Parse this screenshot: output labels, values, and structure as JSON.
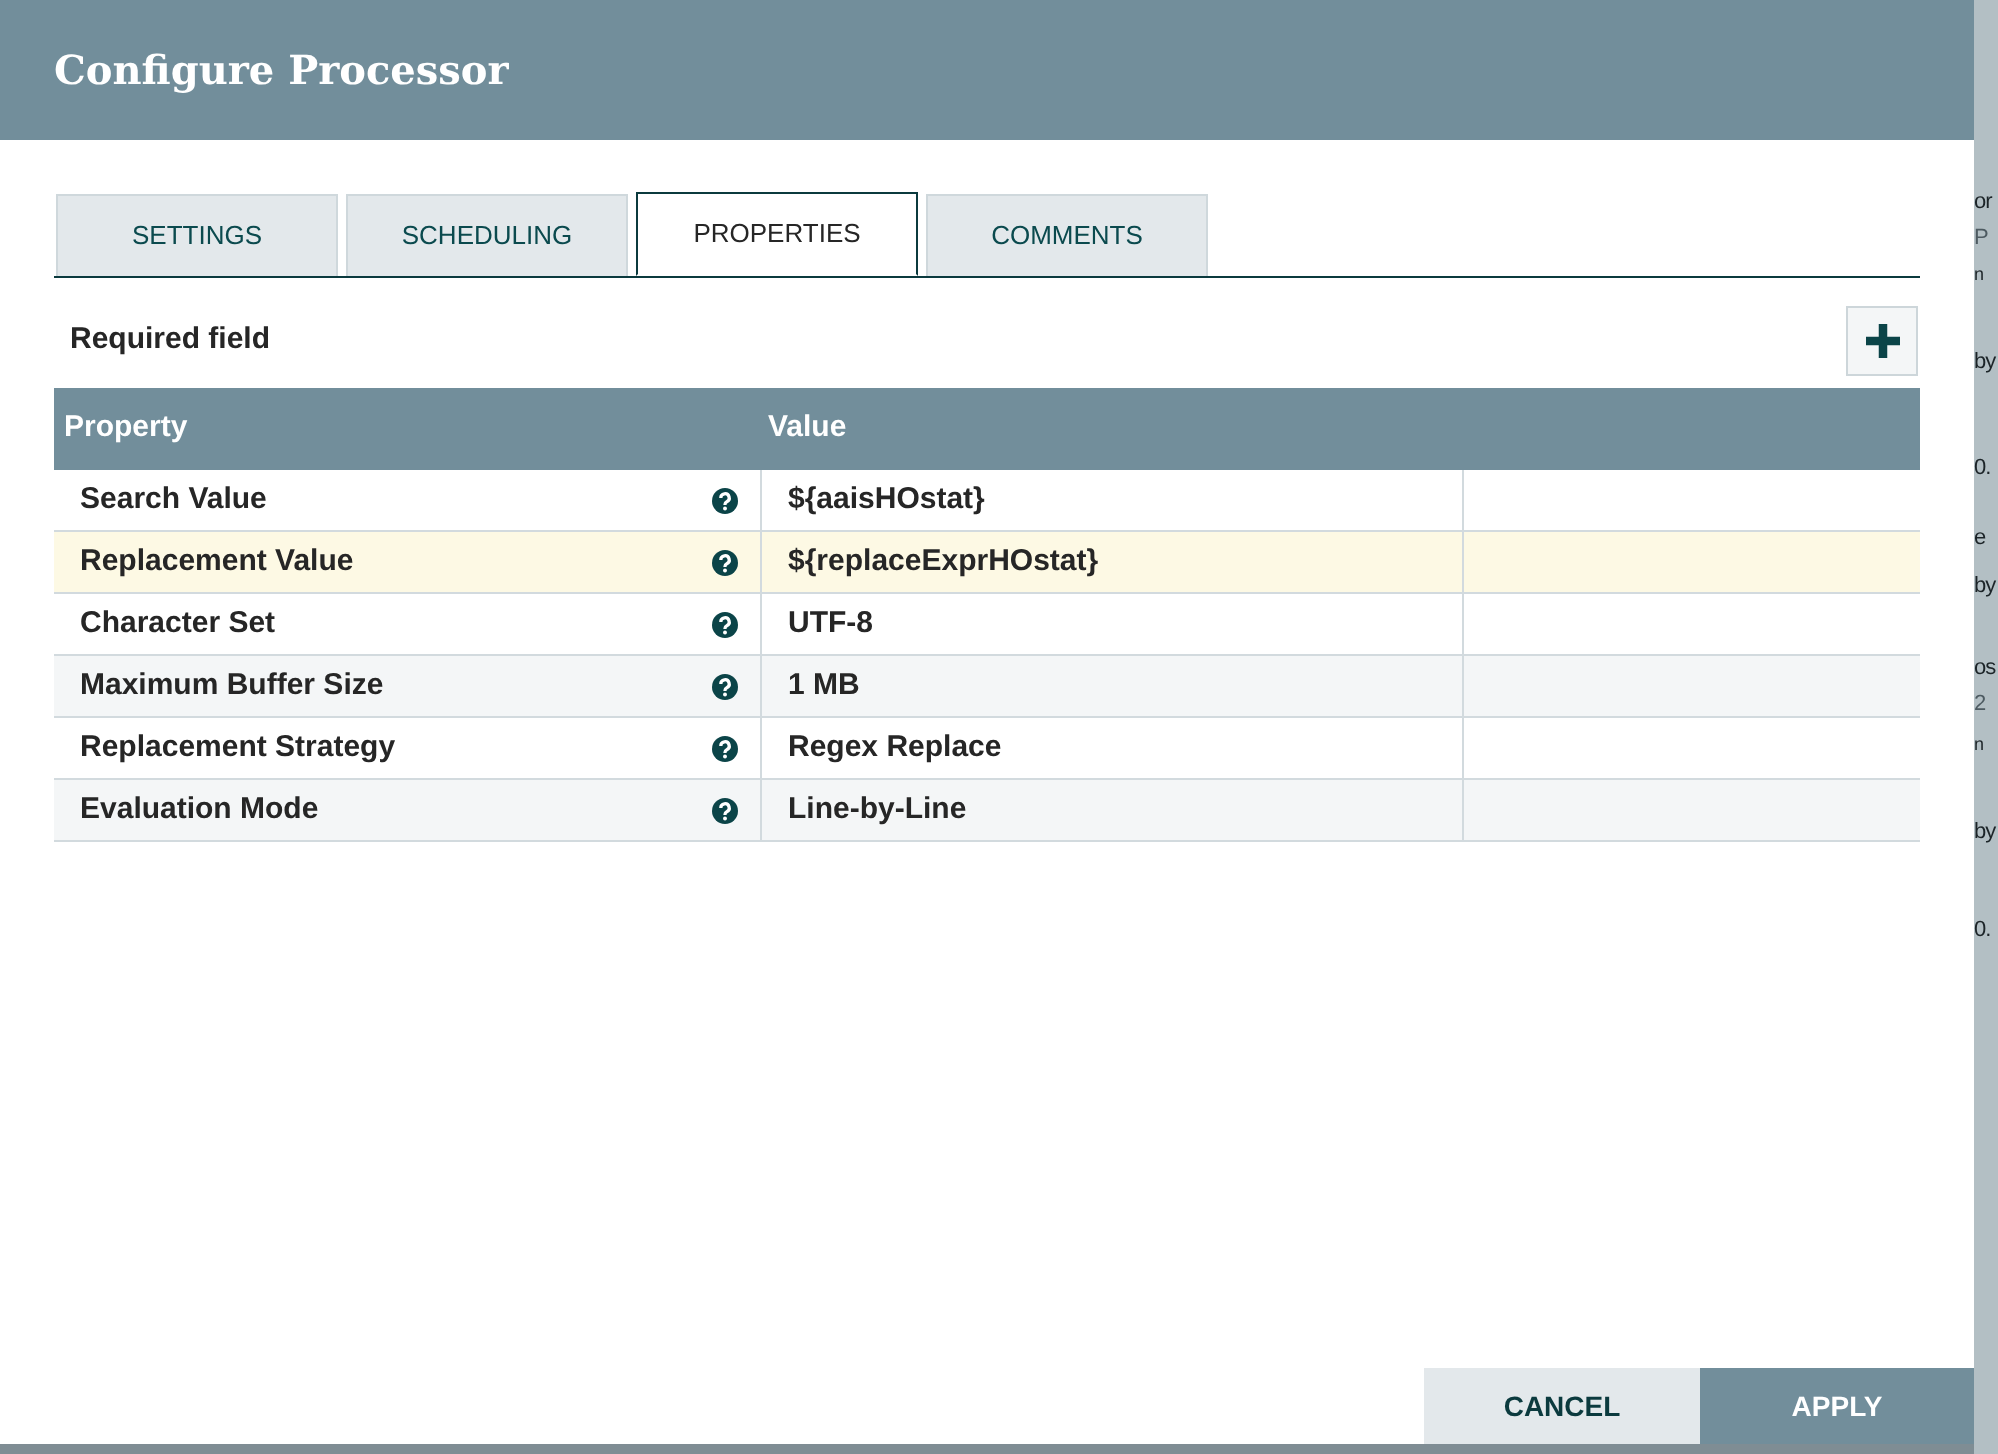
{
  "dialog": {
    "title": "Configure Processor"
  },
  "tabs": [
    {
      "label": "SETTINGS",
      "selected": false
    },
    {
      "label": "SCHEDULING",
      "selected": false
    },
    {
      "label": "PROPERTIES",
      "selected": true
    },
    {
      "label": "COMMENTS",
      "selected": false
    }
  ],
  "required_note": "Required field",
  "table": {
    "columns": [
      "Property",
      "Value"
    ],
    "rows": [
      {
        "property": "Search Value",
        "value": "${aaisHOstat}",
        "selected": false
      },
      {
        "property": "Replacement Value",
        "value": "${replaceExprHOstat}",
        "selected": true
      },
      {
        "property": "Character Set",
        "value": "UTF-8",
        "selected": false
      },
      {
        "property": "Maximum Buffer Size",
        "value": "1 MB",
        "selected": false
      },
      {
        "property": "Replacement Strategy",
        "value": "Regex Replace",
        "selected": false
      },
      {
        "property": "Evaluation Mode",
        "value": "Line-by-Line",
        "selected": false
      }
    ]
  },
  "buttons": [
    {
      "label": "CANCEL",
      "kind": "secondary"
    },
    {
      "label": "APPLY",
      "kind": "primary"
    }
  ],
  "background_canvas": {
    "fragments": [
      {
        "text": "or",
        "muted": false
      },
      {
        "text": "P",
        "muted": true
      },
      {
        "text": "n",
        "muted": false
      },
      {
        "text": "by",
        "muted": false
      },
      {
        "text": "0.",
        "muted": false
      },
      {
        "text": "e",
        "muted": false
      },
      {
        "text": "by",
        "muted": false
      },
      {
        "text": "os",
        "muted": false
      },
      {
        "text": "2",
        "muted": true
      },
      {
        "text": "n",
        "muted": false
      },
      {
        "text": "by",
        "muted": false
      },
      {
        "text": "0.",
        "muted": false
      }
    ]
  }
}
